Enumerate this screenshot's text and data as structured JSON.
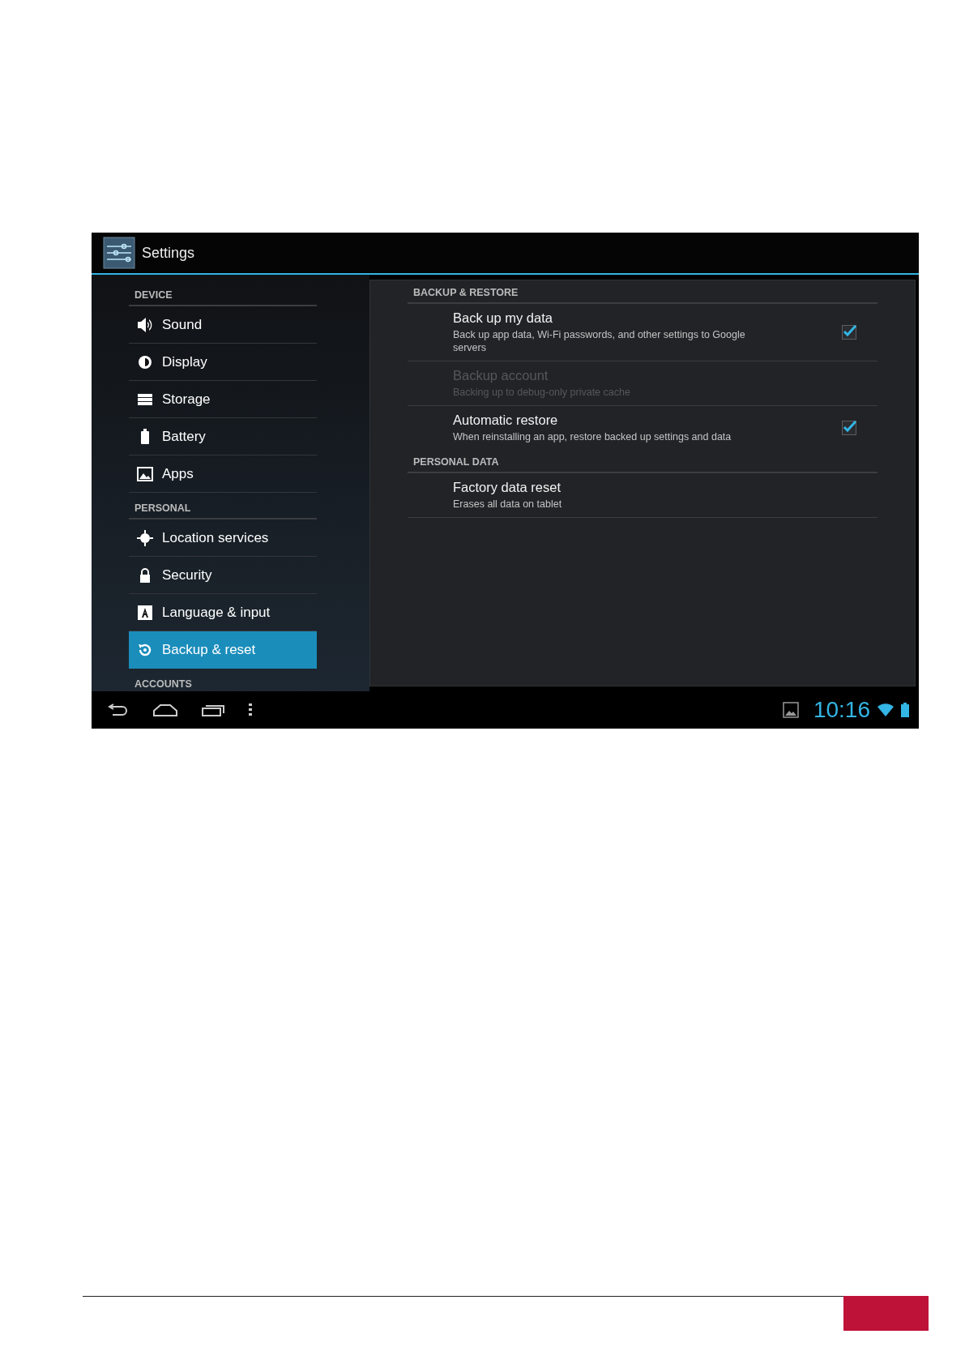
{
  "window": {
    "title": "Settings"
  },
  "sidebar": {
    "sections": [
      {
        "header": "DEVICE",
        "items": [
          {
            "label": "Sound",
            "kind": "sound",
            "selected": false
          },
          {
            "label": "Display",
            "kind": "display",
            "selected": false
          },
          {
            "label": "Storage",
            "kind": "storage",
            "selected": false
          },
          {
            "label": "Battery",
            "kind": "battery",
            "selected": false
          },
          {
            "label": "Apps",
            "kind": "apps",
            "selected": false
          }
        ]
      },
      {
        "header": "PERSONAL",
        "items": [
          {
            "label": "Location services",
            "kind": "location",
            "selected": false
          },
          {
            "label": "Security",
            "kind": "security",
            "selected": false
          },
          {
            "label": "Language & input",
            "kind": "language",
            "selected": false
          },
          {
            "label": "Backup & reset",
            "kind": "backup",
            "selected": true
          }
        ]
      },
      {
        "header": "ACCOUNTS"
      }
    ]
  },
  "detail": {
    "sections": [
      {
        "header": "BACKUP & RESTORE",
        "rows": [
          {
            "title": "Back up my data",
            "summary": "Back up app data, Wi-Fi passwords, and other settings to Google servers",
            "kind": "checkbox",
            "checked": true,
            "disabled": false
          },
          {
            "title": "Backup account",
            "summary": "Backing up to debug-only private cache",
            "kind": "plain",
            "disabled": true
          },
          {
            "title": "Automatic restore",
            "summary": "When reinstalling an app, restore backed up settings and data",
            "kind": "checkbox",
            "checked": true,
            "disabled": false
          }
        ]
      },
      {
        "header": "PERSONAL DATA",
        "rows": [
          {
            "title": "Factory data reset",
            "summary": "Erases all data on tablet",
            "kind": "plain",
            "disabled": false
          }
        ]
      }
    ]
  },
  "status_bar": {
    "time": "10:16"
  }
}
